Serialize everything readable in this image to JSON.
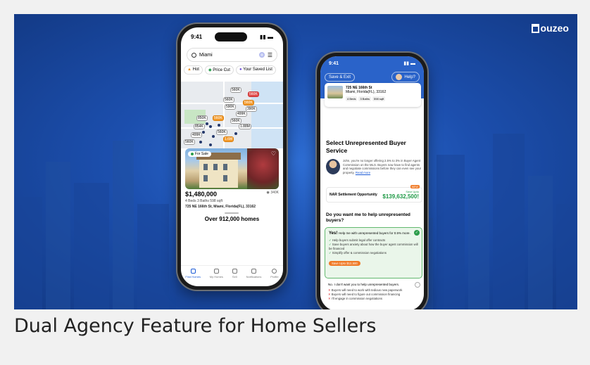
{
  "brand": {
    "name": "Houzeo",
    "initial": "H",
    "rest": "ouzeo"
  },
  "caption": "Dual Agency Feature for Home Sellers",
  "left_phone": {
    "time": "9:41",
    "search_value": "Miami",
    "chips": [
      "Hot",
      "Price Cut",
      "Your Saved List"
    ],
    "map_pins": [
      "560K",
      "560K",
      "560K",
      "560K",
      "390K",
      "590K",
      "850K",
      "499K",
      "560K",
      "560K",
      "854K",
      "1.88M",
      "499K",
      "560K",
      "1.6M",
      "560K"
    ],
    "for_sale": "For Sale",
    "listing": {
      "price": "$1,480,000",
      "views": "340",
      "specs": "4 Beds  3 Baths  598 sqft",
      "address": "725 NE 166th St, Miami, Florida(FL), 33162"
    },
    "count_text": "Over 912,000 homes",
    "nav": [
      "Find Homes",
      "My Homes",
      "Sell",
      "Notifications",
      "Profile"
    ]
  },
  "right_phone": {
    "time": "9:41",
    "save_exit": "Save & Exit",
    "help": "Help?",
    "property": {
      "street": "725 NE 166th St",
      "city": "Miami, Florida(FL), 33162",
      "tags": [
        "4 Beds",
        "3 Baths",
        "598 sqft"
      ]
    },
    "section_title": "Select Unrepresented Buyer Service",
    "agent_text": "John, you're no longer offering 2.5% to 3% in Buyer Agent Commission on the MLS. Buyers now have to find agents and negotiate commissions before they can even see your property.",
    "read_more": "Read more",
    "savings_label": "NAR Settlement Opportunity",
    "savings_sub": "Save Upto",
    "savings_amount": "$139,632,500!",
    "savings_tag": "NEW",
    "question": "Do you want me to help unrepresented buyers?",
    "yes_title": "Yes!",
    "yes_sub": "Help me with unrepresented buyers for 0.5% more.",
    "yes_items": [
      "Help buyers submit legal offer contracts",
      "Save buyers anxiety about how the buyer agent commission will be financed",
      "Simplify offer & commission negotiations"
    ],
    "yes_save": "Save Upto $12,500",
    "no_title": "No.",
    "no_sub": "I don't want you to help unrepresented buyers.",
    "no_items": [
      "Buyers will need to work with tedious new paperwork",
      "Buyers will need to figure out commission financing",
      "I'll engage in commission negotiations"
    ]
  }
}
